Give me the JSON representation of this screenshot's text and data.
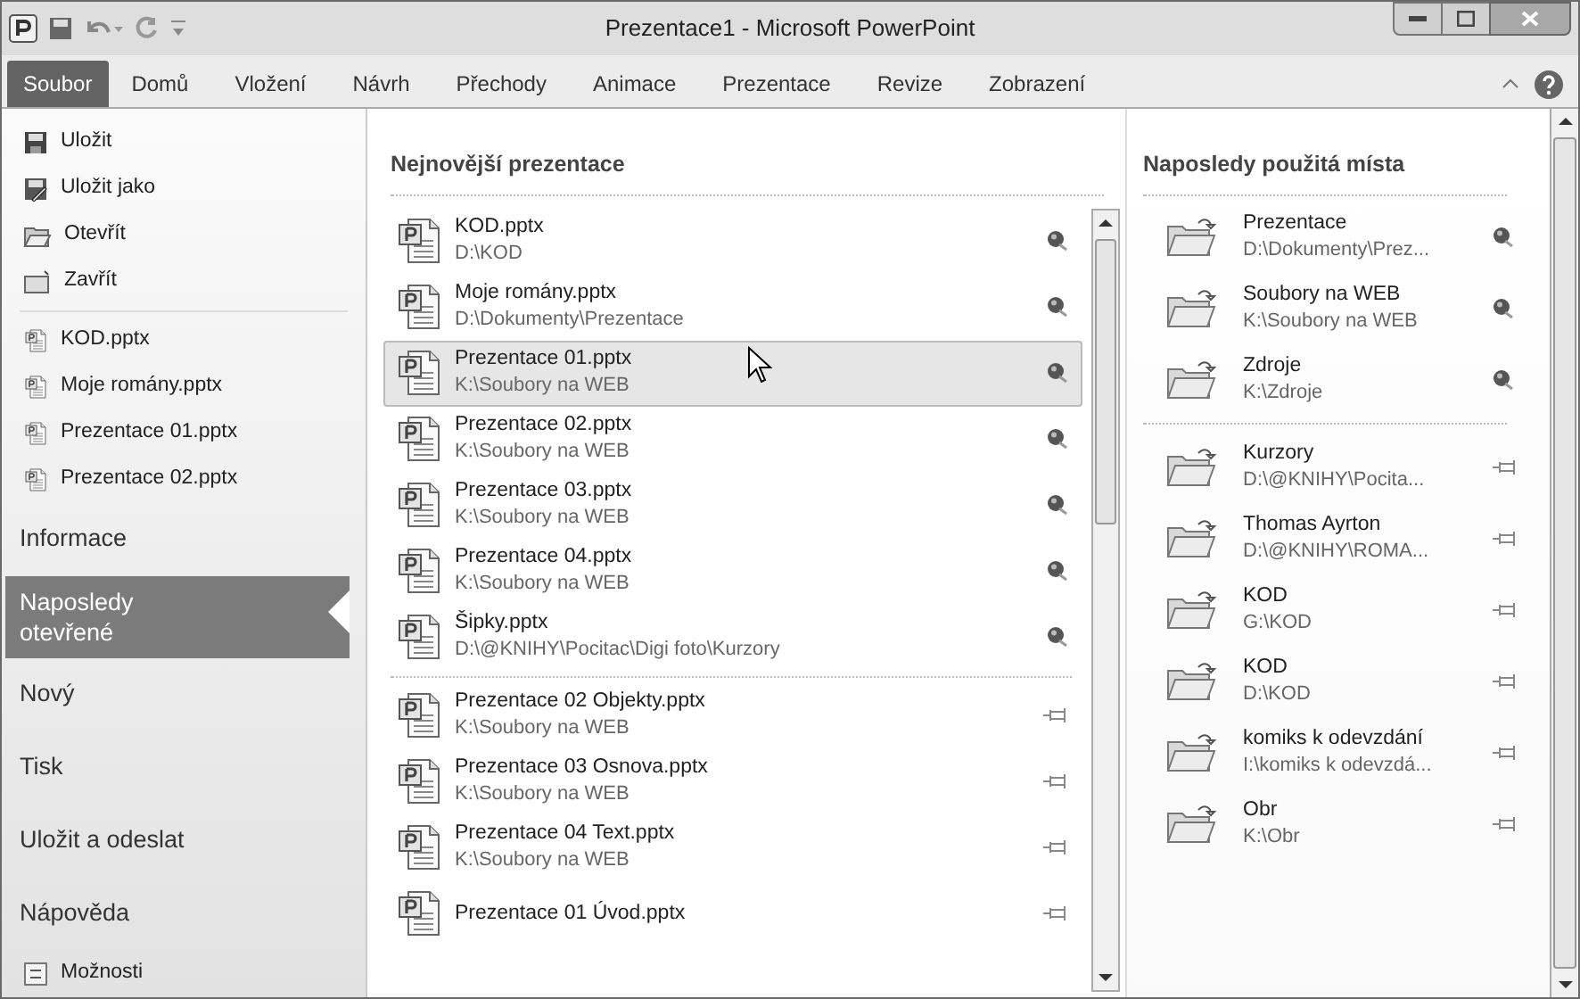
{
  "window": {
    "title": "Prezentace1 - Microsoft PowerPoint"
  },
  "ribbon_tabs": [
    {
      "label": "Soubor",
      "selected": true
    },
    {
      "label": "Domů",
      "selected": false
    },
    {
      "label": "Vložení",
      "selected": false
    },
    {
      "label": "Návrh",
      "selected": false
    },
    {
      "label": "Přechody",
      "selected": false
    },
    {
      "label": "Animace",
      "selected": false
    },
    {
      "label": "Prezentace",
      "selected": false
    },
    {
      "label": "Revize",
      "selected": false
    },
    {
      "label": "Zobrazení",
      "selected": false
    }
  ],
  "sidebar": {
    "items": [
      {
        "kind": "save",
        "label": "Uložit",
        "selected": false
      },
      {
        "kind": "saveas",
        "label": "Uložit jako",
        "selected": false
      },
      {
        "kind": "open",
        "label": "Otevřít",
        "selected": false
      },
      {
        "kind": "close",
        "label": "Zavřít",
        "selected": false
      },
      {
        "kind": "file",
        "label": "KOD.pptx",
        "selected": false
      },
      {
        "kind": "file",
        "label": "Moje romány.pptx",
        "selected": false
      },
      {
        "kind": "file",
        "label": "Prezentace 01.pptx",
        "selected": false
      },
      {
        "kind": "file",
        "label": "Prezentace 02.pptx",
        "selected": false
      },
      {
        "kind": "section",
        "label": "Informace",
        "selected": false
      },
      {
        "kind": "section",
        "label": "Naposledy otevřené",
        "selected": true
      },
      {
        "kind": "section",
        "label": "Nový",
        "selected": false
      },
      {
        "kind": "section",
        "label": "Tisk",
        "selected": false
      },
      {
        "kind": "section",
        "label": "Uložit a odeslat",
        "selected": false
      },
      {
        "kind": "section",
        "label": "Nápověda",
        "selected": false
      },
      {
        "kind": "options",
        "label": "Možnosti",
        "selected": false
      }
    ]
  },
  "recent_presentations": {
    "heading": "Nejnovější prezentace",
    "items": [
      {
        "name": "KOD.pptx",
        "path": "D:\\KOD",
        "pinned": true,
        "highlighted": false
      },
      {
        "name": "Moje romány.pptx",
        "path": "D:\\Dokumenty\\Prezentace",
        "pinned": true,
        "highlighted": false
      },
      {
        "name": "Prezentace 01.pptx",
        "path": "K:\\Soubory na WEB",
        "pinned": true,
        "highlighted": true
      },
      {
        "name": "Prezentace 02.pptx",
        "path": "K:\\Soubory na WEB",
        "pinned": true,
        "highlighted": false
      },
      {
        "name": "Prezentace 03.pptx",
        "path": "K:\\Soubory na WEB",
        "pinned": true,
        "highlighted": false
      },
      {
        "name": "Prezentace 04.pptx",
        "path": "K:\\Soubory na WEB",
        "pinned": true,
        "highlighted": false
      },
      {
        "name": "Šipky.pptx",
        "path": "D:\\@KNIHY\\Pocitac\\Digi foto\\Kurzory",
        "pinned": true,
        "highlighted": false
      },
      {
        "name": "Prezentace 02 Objekty.pptx",
        "path": "K:\\Soubory na WEB",
        "pinned": false,
        "highlighted": false
      },
      {
        "name": "Prezentace 03 Osnova.pptx",
        "path": "K:\\Soubory na WEB",
        "pinned": false,
        "highlighted": false
      },
      {
        "name": "Prezentace 04 Text.pptx",
        "path": "K:\\Soubory na WEB",
        "pinned": false,
        "highlighted": false
      },
      {
        "name": "Prezentace 01 Úvod.pptx",
        "pinned": false,
        "highlighted": false
      }
    ]
  },
  "recent_places": {
    "heading": "Naposledy použitá místa",
    "items": [
      {
        "name": "Prezentace",
        "path": "D:\\Dokumenty\\Prez...",
        "pinned": true
      },
      {
        "name": "Soubory na WEB",
        "path": "K:\\Soubory na WEB",
        "pinned": true
      },
      {
        "name": "Zdroje",
        "path": "K:\\Zdroje",
        "pinned": true
      },
      {
        "name": "Kurzory",
        "path": "D:\\@KNIHY\\Pocita...",
        "pinned": false
      },
      {
        "name": "Thomas Ayrton",
        "path": "D:\\@KNIHY\\ROMA...",
        "pinned": false
      },
      {
        "name": "KOD",
        "path": "G:\\KOD",
        "pinned": false
      },
      {
        "name": "KOD",
        "path": "D:\\KOD",
        "pinned": false
      },
      {
        "name": "komiks k odevzdání",
        "path": "I:\\komiks k odevzdá...",
        "pinned": false
      },
      {
        "name": "Obr",
        "path": "K:\\Obr",
        "pinned": false
      }
    ]
  }
}
